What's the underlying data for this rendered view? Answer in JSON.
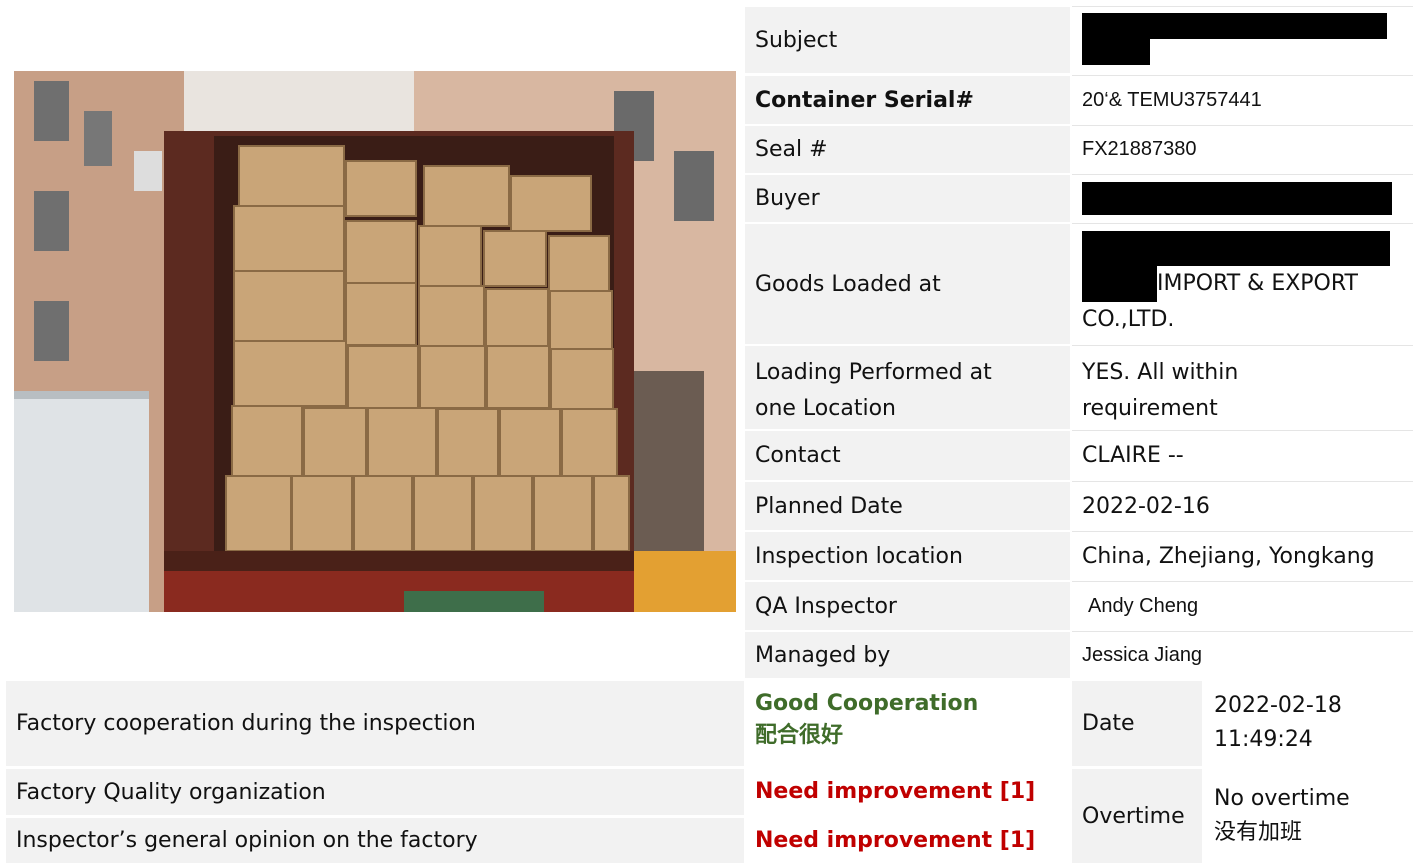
{
  "fields": [
    {
      "label": "Subject",
      "value": ""
    },
    {
      "label": "Container Serial#",
      "value": "20‘& TEMU3757441"
    },
    {
      "label": "Seal #",
      "value": "FX21887380"
    },
    {
      "label": "Buyer",
      "value": ""
    },
    {
      "label": "Goods Loaded at",
      "value_line1": "IMPORT & EXPORT",
      "value_line2": "CO.,LTD."
    },
    {
      "label_line1": "Loading Performed at",
      "label_line2": "one Location",
      "value_line1": "YES. All within",
      "value_line2": "requirement"
    },
    {
      "label": "Contact",
      "value": "CLAIRE --"
    },
    {
      "label": "Planned Date",
      "value": "2022-02-16"
    },
    {
      "label": "Inspection location",
      "value": "China, Zhejiang, Yongkang"
    },
    {
      "label": "QA Inspector",
      "value": "Andy Cheng"
    },
    {
      "label": "Managed by",
      "value": "Jessica Jiang"
    }
  ],
  "bottom": {
    "cooperation_label": "Factory cooperation during the inspection",
    "cooperation_value_en": "Good Cooperation",
    "cooperation_value_cn": "配合很好",
    "date_label": "Date",
    "date_value_line1": "2022-02-18",
    "date_value_line2": "11:49:24",
    "quality_label": "Factory Quality organization",
    "quality_value": "Need improvement [1]",
    "opinion_label": "Inspector’s general opinion on the factory",
    "opinion_value": "Need improvement [1]",
    "overtime_label": "Overtime",
    "overtime_value_en": "No overtime",
    "overtime_value_cn": "没有加班"
  },
  "colors": {
    "good": "#3f6c2a",
    "bad": "#c00000",
    "cell_bg": "#f2f2f2"
  }
}
